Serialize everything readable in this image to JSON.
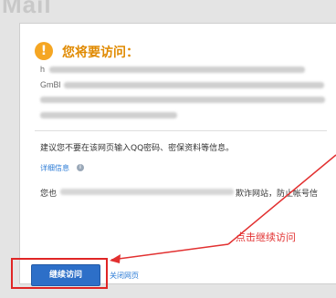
{
  "app": {
    "logo_text": "Mail"
  },
  "warning": {
    "icon": "exclamation-icon",
    "icon_glyph": "!",
    "title": "您将要访问：",
    "url_prefix_1": "h",
    "url_prefix_2": "GmBl"
  },
  "advice": {
    "text": "建议您不要在该网页输入QQ密码、密保资料等信息。",
    "details_link": "详细信息",
    "details_icon": "info-icon",
    "details_icon_glyph": "i"
  },
  "notice": {
    "start": "您也",
    "middle": "欺诈网站，防止帐号信"
  },
  "annotation": {
    "text": "点击继续访问"
  },
  "actions": {
    "continue_label": "继续访问",
    "close_label": "关闭网页"
  },
  "colors": {
    "accent": "#2d6fc8",
    "warning": "#f5a623",
    "title": "#e08a00",
    "annotation": "#e23030"
  }
}
